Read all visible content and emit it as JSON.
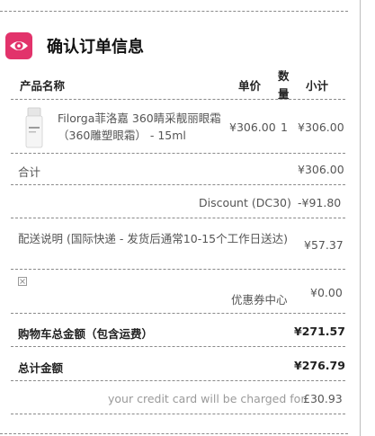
{
  "page": {
    "title": "确认订单信息",
    "icon": "eye-icon",
    "accent_color": "#e2336b"
  },
  "table": {
    "headers": {
      "product": "产品名称",
      "price": "单价",
      "qty_line1": "数",
      "qty_line2": "量",
      "subtotal": "小计"
    },
    "items": [
      {
        "name": "Filorga菲洛嘉 360睛采靓丽眼霜（360雕塑眼霜） - 15ml",
        "price": "¥306.00",
        "qty": "1",
        "subtotal": "¥306.00"
      }
    ]
  },
  "summary": {
    "total_label": "合计",
    "total_value": "¥306.00",
    "discount_label": "Discount (DC30)",
    "discount_value": "-¥91.80",
    "shipping_label": "配送说明 (国际快递 - 发货后通常10-15个工作日送达)",
    "shipping_value": "¥57.37",
    "coupon_label": "优惠券中心",
    "coupon_value": "¥0.00",
    "cart_total_label": "购物车总金额（包含运费）",
    "cart_total_value": "¥271.57",
    "grand_total_label": "总计金额",
    "grand_total_value": "¥276.79",
    "charge_note": "your credit card will be charged for",
    "charge_value": "£30.93"
  }
}
